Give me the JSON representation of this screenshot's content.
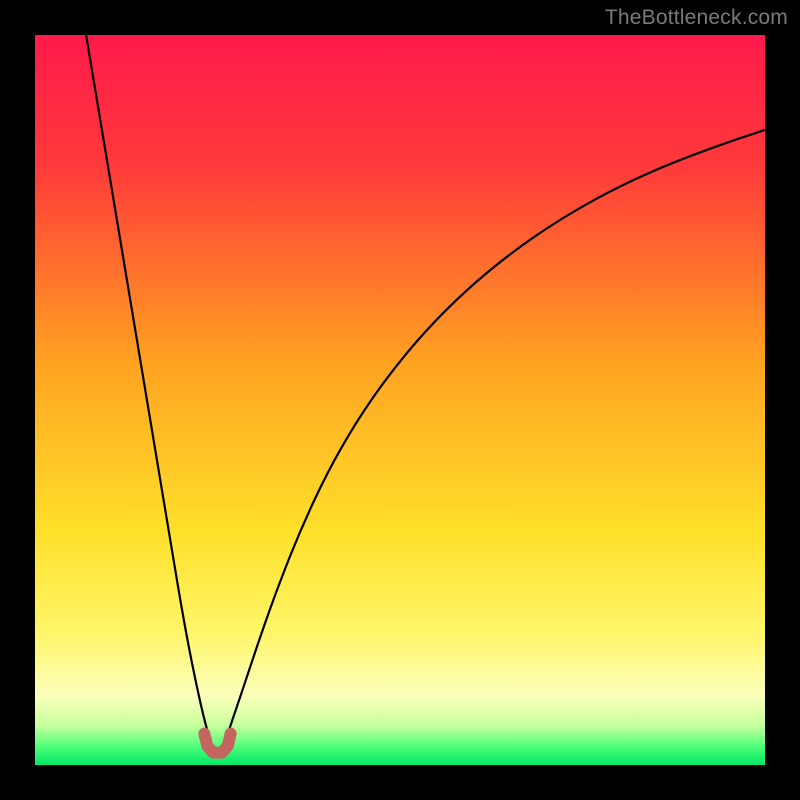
{
  "watermark": "TheBottleneck.com",
  "chart_data": {
    "type": "line",
    "title": "",
    "xlabel": "",
    "ylabel": "",
    "xlim": [
      0,
      100
    ],
    "ylim": [
      0,
      100
    ],
    "background_gradient": {
      "stops": [
        {
          "offset": 0.0,
          "color": "#ff1a4b"
        },
        {
          "offset": 0.18,
          "color": "#ff3a3a"
        },
        {
          "offset": 0.45,
          "color": "#ffa321"
        },
        {
          "offset": 0.68,
          "color": "#ffe02a"
        },
        {
          "offset": 0.82,
          "color": "#fff66a"
        },
        {
          "offset": 0.905,
          "color": "#fcffbc"
        },
        {
          "offset": 0.945,
          "color": "#c8ff9e"
        },
        {
          "offset": 0.975,
          "color": "#4fff7a"
        },
        {
          "offset": 1.0,
          "color": "#00e765"
        }
      ]
    },
    "series": [
      {
        "name": "left-branch",
        "stroke": "#000000",
        "stroke_width": 2.2,
        "x": [
          7,
          8,
          9,
          10,
          11,
          12,
          13,
          14,
          15,
          16,
          17,
          18,
          19,
          20,
          21,
          22,
          23,
          23.8
        ],
        "y": [
          100,
          94,
          88,
          82,
          76,
          70,
          64,
          58,
          52,
          46,
          40,
          34,
          28,
          22,
          16.5,
          11.5,
          7,
          4
        ]
      },
      {
        "name": "right-branch",
        "stroke": "#000000",
        "stroke_width": 2.2,
        "x": [
          26.3,
          27.5,
          29,
          31,
          33.5,
          36.5,
          40,
          44,
          48.5,
          53.5,
          59,
          65,
          71.5,
          78.5,
          86,
          94,
          100
        ],
        "y": [
          4,
          7.5,
          12,
          18,
          25,
          32.5,
          40,
          47,
          53.5,
          59.5,
          65,
          70,
          74.5,
          78.5,
          82,
          85,
          87
        ]
      },
      {
        "name": "cusp-marker",
        "stroke": "#c5655f",
        "stroke_width": 12,
        "linecap": "round",
        "x": [
          23.2,
          23.6,
          24.4,
          25.6,
          26.4,
          26.8
        ],
        "y": [
          4.3,
          2.6,
          1.7,
          1.7,
          2.6,
          4.3
        ]
      }
    ]
  }
}
